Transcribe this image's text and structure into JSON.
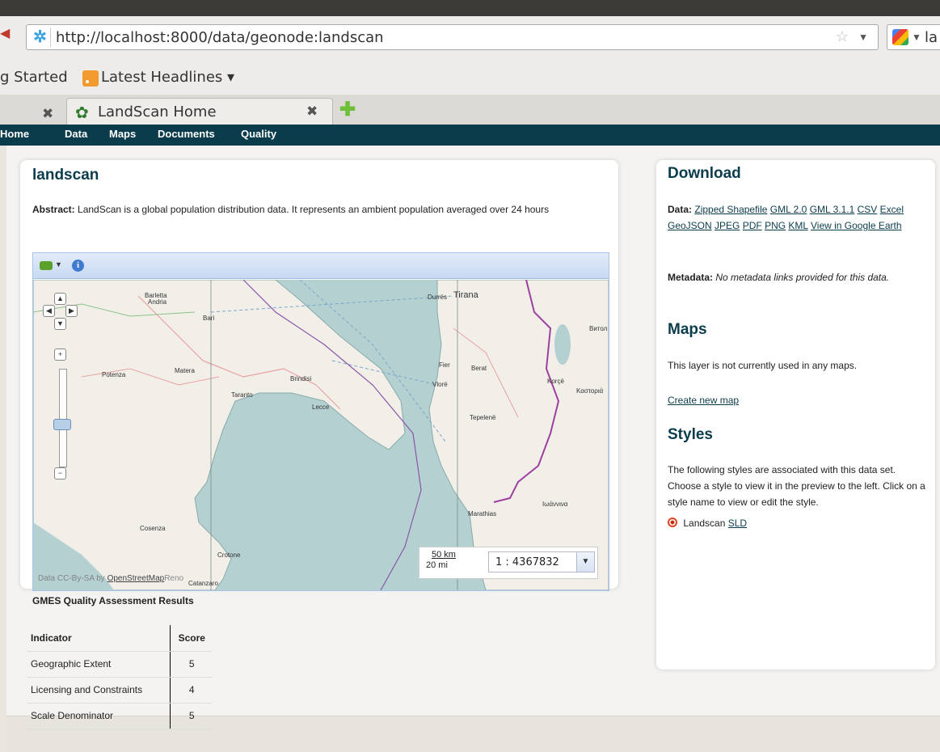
{
  "browser": {
    "url": "http://localhost:8000/data/geonode:landscan",
    "search_text": "la",
    "bookmarks": [
      {
        "label": "g Started"
      },
      {
        "label": "Latest Headlines ▾"
      }
    ],
    "tabs": [
      {
        "label": "LandScan Home"
      }
    ]
  },
  "nav": {
    "items": [
      "Home",
      "Data",
      "Maps",
      "Documents",
      "Quality"
    ]
  },
  "layer": {
    "title": "landscan",
    "abstract_label": "Abstract:",
    "abstract_text": "LandScan is a global population distribution data. It represents an ambient population averaged over 24 hours"
  },
  "map": {
    "scale_value": "1 : 4367832",
    "scale_km": "50 km",
    "scale_mi": "20 mi",
    "attribution_prefix": "Data CC-By-SA by",
    "attribution_link": "OpenStreetMap",
    "attribution_suffix": "Reno",
    "places": [
      {
        "name": "Barletta"
      },
      {
        "name": "Andria"
      },
      {
        "name": "Bari"
      },
      {
        "name": "Potenza"
      },
      {
        "name": "Matera"
      },
      {
        "name": "Taranto"
      },
      {
        "name": "Brindisi"
      },
      {
        "name": "Lecce"
      },
      {
        "name": "Cosenza"
      },
      {
        "name": "Crotone"
      },
      {
        "name": "Catanzaro"
      },
      {
        "name": "Durrës"
      },
      {
        "name": "Tirana"
      },
      {
        "name": "Fier"
      },
      {
        "name": "Berat"
      },
      {
        "name": "Vlorë"
      },
      {
        "name": "Tepelenë"
      },
      {
        "name": "Korçë"
      },
      {
        "name": "Καστοριά"
      },
      {
        "name": "Bитол"
      },
      {
        "name": "Ιωάννινα"
      },
      {
        "name": "Marathias"
      }
    ]
  },
  "quality": {
    "title": "GMES Quality Assessment Results",
    "headers": {
      "indicator": "Indicator",
      "score": "Score"
    },
    "rows": [
      {
        "indicator": "Geographic Extent",
        "score": "5"
      },
      {
        "indicator": "Licensing and Constraints",
        "score": "4"
      },
      {
        "indicator": "Scale Denominator",
        "score": "5"
      }
    ]
  },
  "sidebar": {
    "download_title": "Download",
    "data_label": "Data:",
    "download_links": [
      "Zipped Shapefile",
      "GML 2.0",
      "GML 3.1.1",
      "CSV",
      "Excel",
      "GeoJSON",
      "JPEG",
      "PDF",
      "PNG",
      "KML",
      "View in Google Earth"
    ],
    "metadata_label": "Metadata:",
    "metadata_text": "No metadata links provided for this data.",
    "maps_title": "Maps",
    "maps_text": "This layer is not currently used in any maps.",
    "create_map": "Create new map",
    "styles_title": "Styles",
    "styles_text": "The following styles are associated with this data set. Choose a style to view it in the preview to the left. Click on a style name to view or edit the style.",
    "style_name": "Landscan",
    "style_link": "SLD"
  },
  "colors": {
    "nav_bg": "#0b3c4c",
    "sea": "#b3d1d1",
    "land": "#f2efe9",
    "border": "#9e3fa0"
  }
}
